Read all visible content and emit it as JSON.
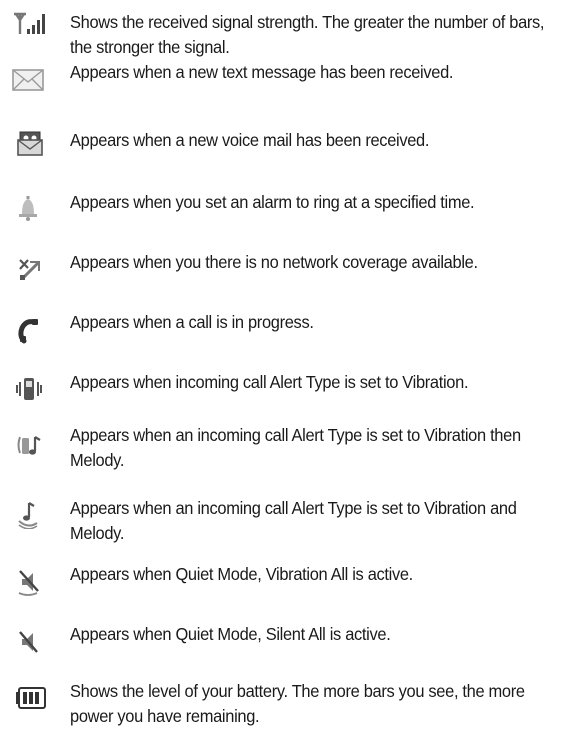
{
  "items": [
    {
      "icon": "signal-strength-icon",
      "text": "Shows the received signal strength. The greater the number of bars, the stronger the signal."
    },
    {
      "icon": "text-message-icon",
      "text": "Appears when a new text message has been received."
    },
    {
      "icon": "voice-mail-icon",
      "text": "Appears when a new voice mail has been received."
    },
    {
      "icon": "alarm-bell-icon",
      "text": "Appears when you set an alarm to ring at a specified time."
    },
    {
      "icon": "no-network-icon",
      "text": "Appears when you there is no network coverage available."
    },
    {
      "icon": "call-in-progress-icon",
      "text": "Appears when a call is in progress."
    },
    {
      "icon": "vibration-icon",
      "text": "Appears when incoming call Alert Type is set to Vibration."
    },
    {
      "icon": "vibration-then-melody-icon",
      "text": "Appears when an incoming call Alert Type is set to Vibration then Melody."
    },
    {
      "icon": "vibration-and-melody-icon",
      "text": "Appears when an incoming call Alert Type is set to Vibration and Melody."
    },
    {
      "icon": "quiet-vibration-all-icon",
      "text": "Appears when Quiet Mode, Vibration All is active."
    },
    {
      "icon": "quiet-silent-all-icon",
      "text": "Appears when Quiet Mode, Silent All is active."
    },
    {
      "icon": "battery-level-icon",
      "text": "Shows the level of your battery. The more bars you see, the more power you have remaining."
    }
  ]
}
